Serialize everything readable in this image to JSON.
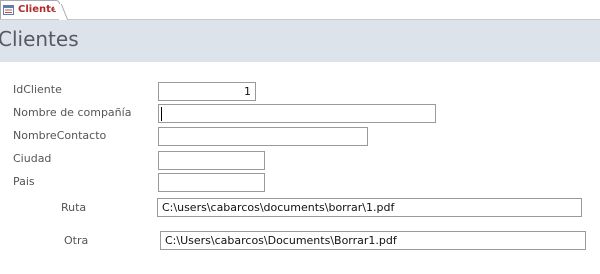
{
  "tab": {
    "label": "Clientes",
    "icon": "form-icon"
  },
  "form": {
    "title": "Clientes"
  },
  "fields": {
    "idcliente": {
      "label": "IdCliente",
      "value": "1"
    },
    "nombre_compania": {
      "label": "Nombre de compañía",
      "value": ""
    },
    "nombre_contacto": {
      "label": "NombreContacto",
      "value": ""
    },
    "ciudad": {
      "label": "Ciudad",
      "value": ""
    },
    "pais": {
      "label": "Pais",
      "value": ""
    },
    "ruta": {
      "label": "Ruta",
      "value": "C:\\users\\cabarcos\\documents\\borrar\\1.pdf"
    },
    "otra": {
      "label": "Otra",
      "value": "C:\\Users\\cabarcos\\Documents\\Borrar1.pdf"
    }
  },
  "colors": {
    "header_band": "#dde3ea",
    "tab_text": "#b22a2a"
  }
}
